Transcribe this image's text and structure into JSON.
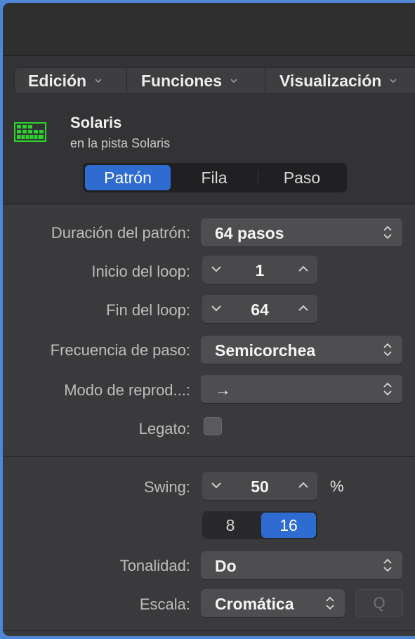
{
  "menubar": {
    "items": [
      {
        "label": "Edición"
      },
      {
        "label": "Funciones"
      },
      {
        "label": "Visualización"
      }
    ]
  },
  "region": {
    "name": "Solaris",
    "subtitle": "en la pista Solaris",
    "icon": "step-sequencer-grid-icon",
    "icon_color": "#2bd42b"
  },
  "tabs": {
    "items": [
      {
        "label": "Patrón",
        "active": true
      },
      {
        "label": "Fila",
        "active": false
      },
      {
        "label": "Paso",
        "active": false
      }
    ]
  },
  "params": {
    "pattern_length": {
      "label": "Duración del patrón:",
      "value": "64 pasos"
    },
    "loop_start": {
      "label": "Inicio del loop:",
      "value": "1"
    },
    "loop_end": {
      "label": "Fin del loop:",
      "value": "64"
    },
    "step_rate": {
      "label": "Frecuencia de paso:",
      "value": "Semicorchea"
    },
    "playback_mode": {
      "label": "Modo de reprod...:",
      "value": "→"
    },
    "legato": {
      "label": "Legato:",
      "checked": false
    }
  },
  "swing": {
    "label": "Swing:",
    "value": "50",
    "unit": "%",
    "resolution_options": [
      {
        "label": "8",
        "active": false
      },
      {
        "label": "16",
        "active": true
      }
    ]
  },
  "key": {
    "label": "Tonalidad:",
    "value": "Do"
  },
  "scale": {
    "label": "Escala:",
    "value": "Cromática",
    "quantize_label": "Q"
  },
  "colors": {
    "accent": "#2f6cd2",
    "window_frame": "#4f87d6"
  }
}
